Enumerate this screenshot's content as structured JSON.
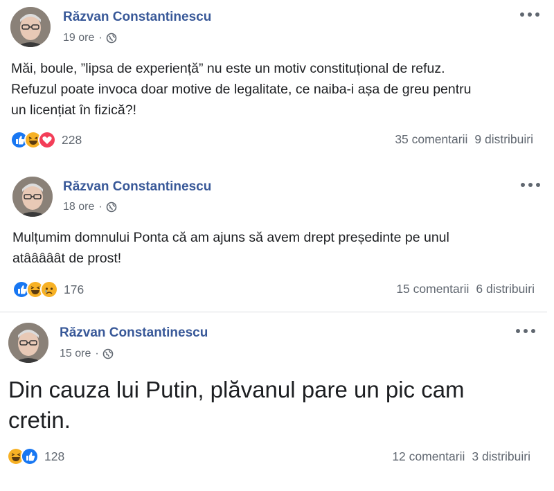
{
  "posts": [
    {
      "author": "Răzvan Constantinescu",
      "time": "19 ore",
      "text": "Măi, boule, ”lipsa de experiență” nu este un motiv constituțional de refuz.\nRefuzul poate invoca doar motive de legalitate, ce naiba-i așa de greu pentru\nun licențiat în fizică?!",
      "reactions": [
        "like",
        "haha",
        "love"
      ],
      "reaction_count": "228",
      "comments": "35 comentarii",
      "shares": "9 distribuiri"
    },
    {
      "author": "Răzvan Constantinescu",
      "time": "18 ore",
      "text": "Mulțumim domnului Ponta că am ajuns să avem drept președinte pe unul\natââââât de prost!",
      "reactions": [
        "like",
        "haha",
        "sad"
      ],
      "reaction_count": "176",
      "comments": "15 comentarii",
      "shares": "6 distribuiri"
    },
    {
      "author": "Răzvan Constantinescu",
      "time": "15 ore",
      "text": "Din cauza lui Putin, plăvanul pare un pic cam\ncretin.",
      "reactions": [
        "haha",
        "like"
      ],
      "reaction_count": "128",
      "comments": "12 comentarii",
      "shares": "3 distribuiri"
    }
  ],
  "colors": {
    "author": "#385898",
    "meta": "#606770",
    "like": "#1877f2",
    "love": "#f33e58",
    "haha": "#f7b125"
  },
  "icons": {
    "privacy": "globe-icon",
    "menu": "more-options-icon"
  }
}
